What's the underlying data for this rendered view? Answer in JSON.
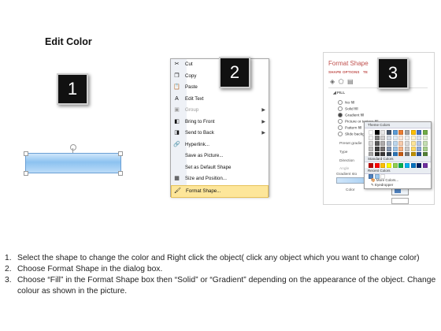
{
  "heading": "Edit Color",
  "badges": [
    "1",
    "2",
    "3"
  ],
  "context_menu": {
    "items": [
      {
        "icon": "scissors-icon",
        "glyph": "✂",
        "label": "Cut",
        "disabled": false,
        "submenu": false
      },
      {
        "icon": "copy-icon",
        "glyph": "❐",
        "label": "Copy",
        "disabled": false,
        "submenu": false
      },
      {
        "icon": "paste-icon",
        "glyph": "📋",
        "label": "Paste",
        "disabled": false,
        "submenu": false
      },
      {
        "icon": "edit-text-icon",
        "glyph": "A",
        "label": "Edit Text",
        "disabled": false,
        "submenu": false
      },
      {
        "icon": "group-icon",
        "glyph": "▣",
        "label": "Group",
        "disabled": true,
        "submenu": true
      },
      {
        "icon": "bring-front-icon",
        "glyph": "◧",
        "label": "Bring to Front",
        "disabled": false,
        "submenu": true
      },
      {
        "icon": "send-back-icon",
        "glyph": "◨",
        "label": "Send to Back",
        "disabled": false,
        "submenu": true
      },
      {
        "icon": "hyperlink-icon",
        "glyph": "🔗",
        "label": "Hyperlink...",
        "disabled": false,
        "submenu": false
      },
      {
        "icon": "",
        "glyph": "",
        "label": "Save as Picture...",
        "disabled": false,
        "submenu": false
      },
      {
        "icon": "",
        "glyph": "",
        "label": "Set as Default Shape",
        "disabled": false,
        "submenu": false
      },
      {
        "icon": "size-position-icon",
        "glyph": "▦",
        "label": "Size and Position...",
        "disabled": false,
        "submenu": false
      },
      {
        "icon": "format-shape-icon",
        "glyph": "🖌",
        "label": "Format Shape...",
        "disabled": false,
        "submenu": false,
        "highlighted": true
      }
    ]
  },
  "format_pane": {
    "title": "Format Shape",
    "tab": "SHAPE OPTIONS",
    "tab2": "TE",
    "section": "FILL",
    "options": [
      {
        "label": "No fill",
        "selected": false
      },
      {
        "label": "Solid fill",
        "selected": false
      },
      {
        "label": "Gradient fill",
        "selected": true
      },
      {
        "label": "Picture or texture fill",
        "selected": false
      },
      {
        "label": "Pattern fill",
        "selected": false
      },
      {
        "label": "Slide backg",
        "selected": false
      }
    ],
    "labels": [
      "Preset gradie",
      "Type",
      "Direction",
      "Angle",
      "Gradient sto"
    ],
    "color_label": "Color"
  },
  "color_popup": {
    "theme_header": "Theme Colors",
    "standard_header": "Standard Colors",
    "recent_header": "Recent Colors",
    "more_colors": "More Colors...",
    "eyedropper": "Eyedropper",
    "theme_rows": [
      [
        "#ffffff",
        "#000000",
        "#e7e6e6",
        "#44546a",
        "#5b9bd5",
        "#ed7d31",
        "#a5a5a5",
        "#ffc000",
        "#4472c4",
        "#70ad47"
      ],
      [
        "#f2f2f2",
        "#7f7f7f",
        "#d0cece",
        "#d6dce4",
        "#deebf6",
        "#fbe5d5",
        "#ededed",
        "#fff2cc",
        "#d9e2f3",
        "#e2efd9"
      ],
      [
        "#d8d8d8",
        "#595959",
        "#aeabab",
        "#adb9ca",
        "#bdd7ee",
        "#f7cbac",
        "#dbdbdb",
        "#fee599",
        "#b4c6e7",
        "#c5e0b3"
      ],
      [
        "#bfbfbf",
        "#3f3f3f",
        "#757070",
        "#8496b0",
        "#9cc3e5",
        "#f4b183",
        "#c9c9c9",
        "#ffd965",
        "#8eaadb",
        "#a8d08d"
      ],
      [
        "#a5a5a5",
        "#262626",
        "#3a3838",
        "#323f4f",
        "#2e75b5",
        "#c55a11",
        "#7b7b7b",
        "#bf9000",
        "#2f5496",
        "#538135"
      ],
      [
        "#7f7f7f",
        "#0c0c0c",
        "#171616",
        "#222a35",
        "#1e4e79",
        "#843c0b",
        "#525252",
        "#7f6000",
        "#1f3864",
        "#375623"
      ]
    ],
    "standard_row": [
      "#c00000",
      "#ff0000",
      "#ffc000",
      "#ffff00",
      "#92d050",
      "#00b050",
      "#00b0f0",
      "#0070c0",
      "#002060",
      "#7030a0"
    ],
    "recent_row": [
      "#4f81bd",
      "#9cc8ef",
      "#ffffff"
    ]
  },
  "instructions": [
    {
      "num": "1.",
      "text": "Select the shape to change the color and Right click the object( click any object which you want to change color)"
    },
    {
      "num": "2.",
      "text": "Choose Format Shape in the dialog box."
    },
    {
      "num": "3.",
      "text": "Choose “Fill” in the Format Shape box then “Solid” or “Gradient” depending on the appearance of the object. Change colour as shown in the picture."
    }
  ]
}
